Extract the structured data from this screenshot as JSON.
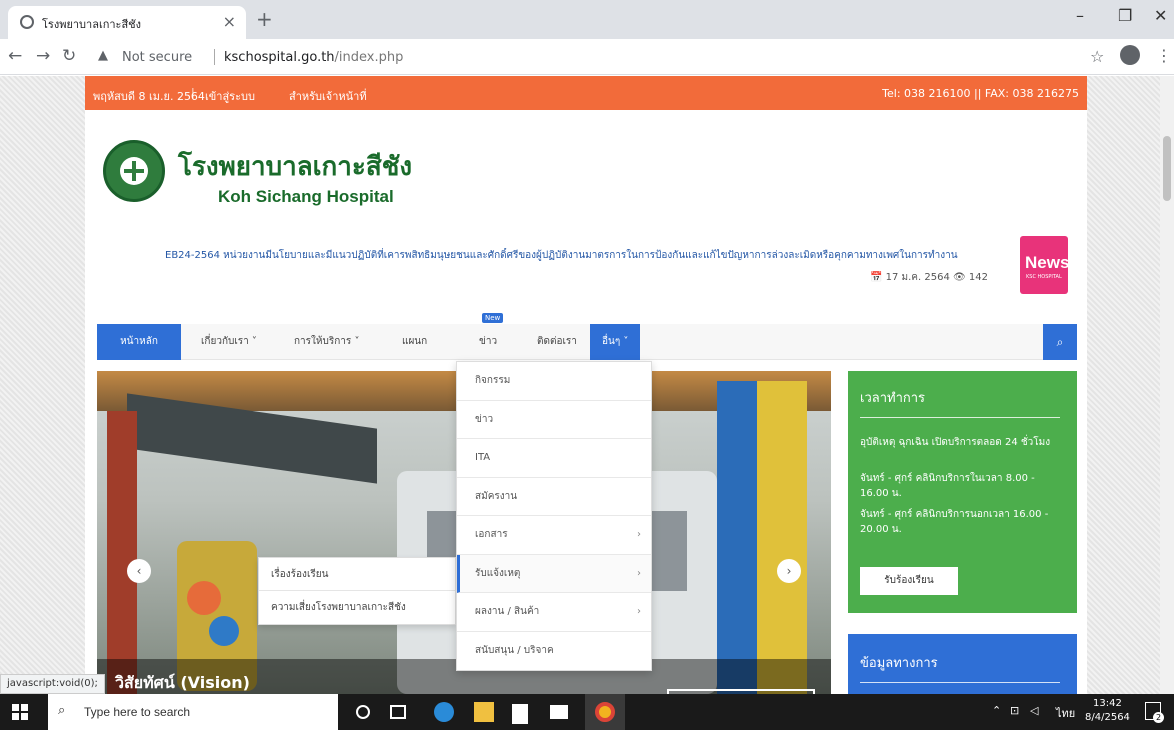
{
  "browser": {
    "tab_title": "โรงพยาบาลเกาะสีชัง",
    "close": "×",
    "new_tab": "+",
    "security_label": "Not secure",
    "url_host": "kschospital.go.th",
    "url_path": "/index.php",
    "status_url": "javascript:void(0);"
  },
  "topbar": {
    "date": "พฤหัสบดี 8 เม.ย. 2564",
    "divider": "|",
    "login": "เข้าสู่ระบบ",
    "staff": "สำหรับเจ้าหน้าที่",
    "contact": "Tel: 038 216100 || FAX: 038 216275"
  },
  "header": {
    "title_th": "โรงพยาบาลเกาะสีชัง",
    "title_en": "Koh Sichang Hospital",
    "ticker": "EB24-2564 หน่วยงานมีนโยบายและมีแนวปฏิบัติที่เคารพสิทธิมนุษยชนและศักดิ์ศรีของผู้ปฏิบัติงานมาตรการในการป้องกันและแก้ไขปัญหาการล่วงละเมิดหรือคุกคามทางเพศในการทำงาน",
    "ticker_meta": "📅 17 ม.ค. 2564 👁 142",
    "news_badge": "News",
    "news_badge_sub": "KSC HOSPITAL"
  },
  "nav": {
    "home": "หน้าหลัก",
    "about": "เกี่ยวกับเรา ˅",
    "services": "การให้บริการ ˅",
    "departments": "แผนก",
    "news": "ข่าว",
    "new_badge": "New",
    "contact": "ติดต่อเรา",
    "more": "อื่นๆ ˅"
  },
  "dropdown": [
    {
      "label": "กิจกรรม",
      "chevron": ""
    },
    {
      "label": "ข่าว",
      "chevron": ""
    },
    {
      "label": "ITA",
      "chevron": ""
    },
    {
      "label": "สมัครงาน",
      "chevron": ""
    },
    {
      "label": "เอกสาร",
      "chevron": "›"
    },
    {
      "label": "รับแจ้งเหตุ",
      "chevron": "›"
    },
    {
      "label": "ผลงาน / สินค้า",
      "chevron": "›"
    },
    {
      "label": "สนับสนุน / บริจาค",
      "chevron": ""
    }
  ],
  "submenu": [
    {
      "label": "เรื่องร้องเรียน"
    },
    {
      "label": "ความเสี่ยงโรงพยาบาลเกาะสีชัง"
    }
  ],
  "slider": {
    "caption": "วิสัยทัศน์ (Vision)",
    "prev": "‹",
    "next": "›"
  },
  "hours_card": {
    "title": "เวลาทำการ",
    "line1": "อุบัติเหตุ ฉุกเฉิน เปิดบริการตลอด 24 ชั่วโมง",
    "line2": "จันทร์ - ศุกร์ คลินิกบริการในเวลา 8.00 - 16.00 น.",
    "line3": "จันทร์ - ศุกร์ คลินิกบริการนอกเวลา 16.00 - 20.00 น.",
    "button": "รับร้องเรียน"
  },
  "info_card": {
    "title": "ข้อมูลทางการ"
  },
  "taskbar": {
    "search_placeholder": "Type here to search",
    "lang": "ไทย",
    "time": "13:42",
    "date": "8/4/2564",
    "notif_count": "2"
  }
}
